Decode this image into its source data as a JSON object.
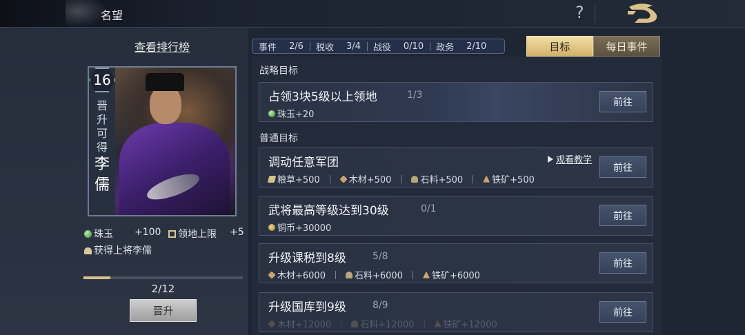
{
  "header": {
    "title": "名望",
    "help_icon": "?"
  },
  "left_panel": {
    "ranking_link": "查看排行榜",
    "level": "16",
    "side_text": "晋升可得",
    "general_name": "李儒",
    "rewards": [
      {
        "icon": "gem-icon",
        "label": "珠玉",
        "value": "+100"
      },
      {
        "icon": "territory-icon",
        "label": "领地上限",
        "value": "+5"
      }
    ],
    "general_reward": "获得上将李儒",
    "progress_text": "2/12",
    "progress_fraction": 0.167,
    "promote_label": "晋升"
  },
  "stats": [
    {
      "label": "事件",
      "value": "2/6"
    },
    {
      "label": "税收",
      "value": "3/4"
    },
    {
      "label": "战役",
      "value": "0/10"
    },
    {
      "label": "政务",
      "value": "2/10"
    }
  ],
  "tabs": [
    {
      "label": "目标",
      "active": true
    },
    {
      "label": "每日事件",
      "active": false
    }
  ],
  "sections": {
    "strategic": "战略目标",
    "normal": "普通目标"
  },
  "go_label": "前往",
  "tutorial_label": "观看教学",
  "tasks": [
    {
      "title": "占领3块5级以上领地",
      "progress": "1/3",
      "rewards": [
        {
          "icon": "gem",
          "text": "珠玉+20"
        }
      ]
    },
    {
      "title": "调动任意军团",
      "progress": "",
      "rewards": [
        {
          "icon": "grain",
          "text": "粮草+500"
        },
        {
          "icon": "wood",
          "text": "木材+500"
        },
        {
          "icon": "stone",
          "text": "石料+500"
        },
        {
          "icon": "iron",
          "text": "铁矿+500"
        }
      ]
    },
    {
      "title": "武将最高等级达到30级",
      "progress": "0/1",
      "rewards": [
        {
          "icon": "coin",
          "text": "铜币+30000"
        }
      ]
    },
    {
      "title": "升级课税到8级",
      "progress": "5/8",
      "rewards": [
        {
          "icon": "wood",
          "text": "木材+6000"
        },
        {
          "icon": "stone",
          "text": "石料+6000"
        },
        {
          "icon": "iron",
          "text": "铁矿+6000"
        }
      ]
    },
    {
      "title": "升级国库到9级",
      "progress": "8/9",
      "rewards": [
        {
          "icon": "wood",
          "text": "木材+12000"
        },
        {
          "icon": "stone",
          "text": "石料+12000"
        },
        {
          "icon": "iron",
          "text": "铁矿+12000"
        }
      ]
    }
  ]
}
